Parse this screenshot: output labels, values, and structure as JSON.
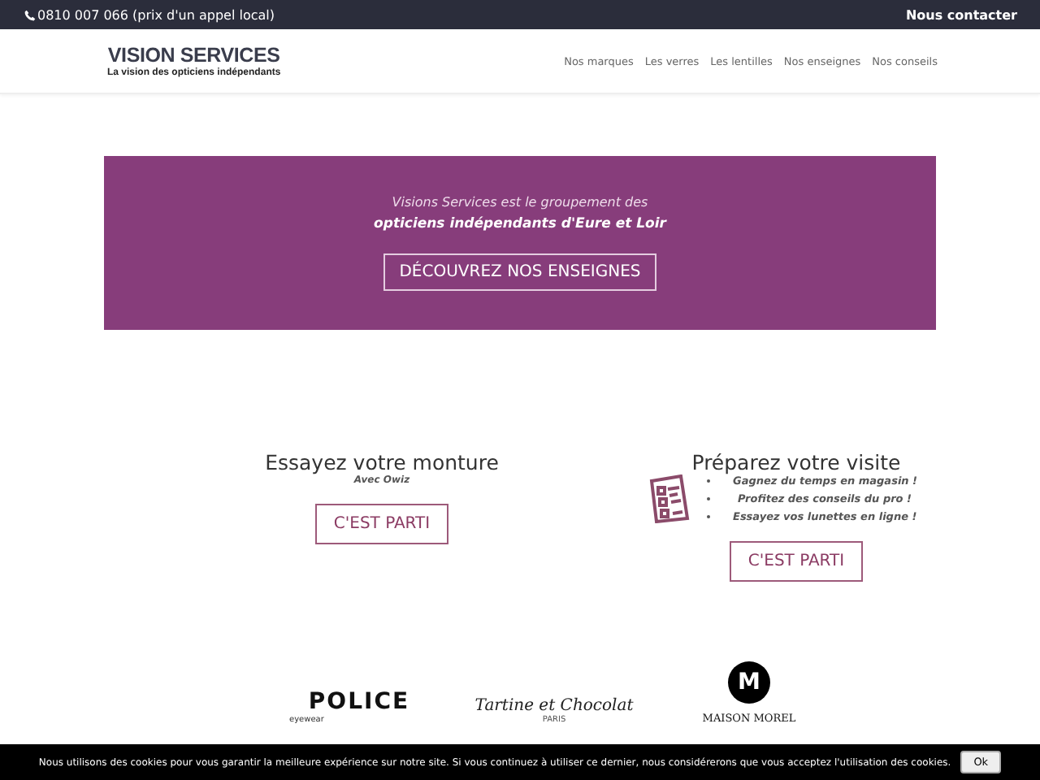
{
  "top_bar": {
    "phone": "0810 007 066 (prix d'un appel local)",
    "contact": "Nous contacter"
  },
  "header": {
    "logo_title": "VISION SERVICES",
    "logo_tagline": "La vision des opticiens indépendants",
    "nav": [
      "Nos marques",
      "Les verres",
      "Les lentilles",
      "Nos enseignes",
      "Nos conseils"
    ]
  },
  "hero": {
    "intro": "Visions Services est le groupement des",
    "highlight": "opticiens indépendants d'Eure et Loir",
    "button": "DÉCOUVREZ NOS ENSEIGNES"
  },
  "cards": [
    {
      "title": "Essayez votre monture",
      "subtitle": "Avec Owiz",
      "button": "C'EST PARTI"
    },
    {
      "title": "Préparez votre visite",
      "bullets": [
        "Gagnez du temps en magasin !",
        "Profitez des conseils du pro !",
        "Essayez vos lunettes en ligne !"
      ],
      "button": "C'EST PARTI"
    }
  ],
  "brands": [
    {
      "kind": "block",
      "name": "POLICE",
      "sub": "eyewear"
    },
    {
      "kind": "script",
      "name": "Tartine et Chocolat",
      "sub": "PARIS"
    },
    {
      "kind": "badge",
      "mark": "M",
      "name": "MAISON MOREL"
    }
  ],
  "cookie_bar": {
    "message": "Nous utilisons des cookies pour vous garantir la meilleure expérience sur notre site. Si vous continuez à utiliser ce dernier, nous considérerons que vous acceptez l'utilisation des cookies.",
    "button": "Ok"
  }
}
